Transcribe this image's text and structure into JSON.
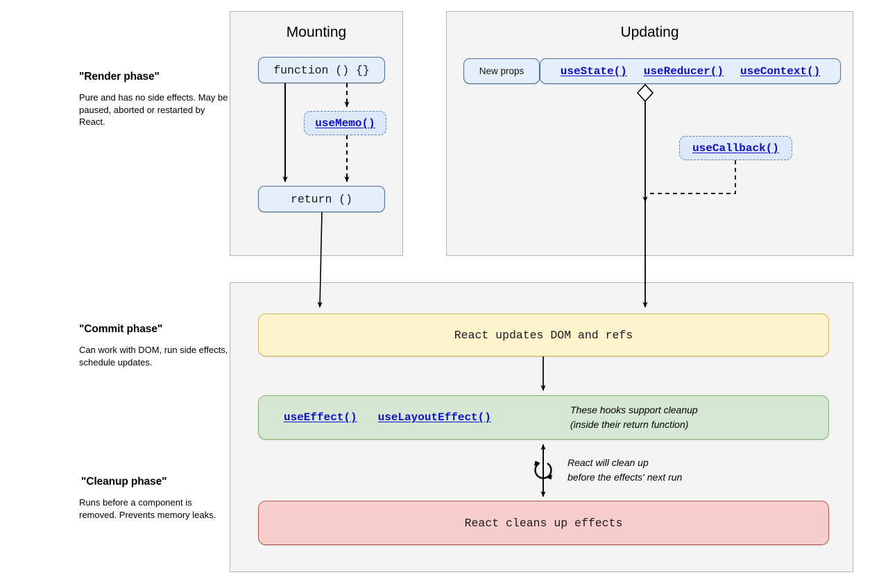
{
  "phases": [
    {
      "id": "render",
      "title": "\"Render phase\"",
      "description": "Pure and has no side effects. May be paused, aborted or restarted by React."
    },
    {
      "id": "commit",
      "title": "\"Commit phase\"",
      "description": "Can work with DOM, run side effects, schedule updates."
    },
    {
      "id": "cleanup",
      "title": "\"Cleanup phase\"",
      "description": "Runs before a component is removed. Prevents memory leaks."
    }
  ],
  "panels": {
    "mounting": {
      "title": "Mounting"
    },
    "updating": {
      "title": "Updating"
    },
    "commit": {
      "title": ""
    }
  },
  "mounting": {
    "function_box": "function () {}",
    "usememo": "useMemo()",
    "return_box": "return ()"
  },
  "updating": {
    "new_props": "New props",
    "hooks": [
      "useState()",
      "useReducer()",
      "useContext()"
    ],
    "usecallback": "useCallback()"
  },
  "commit": {
    "updates_dom": "React updates DOM and refs",
    "effect_hooks": [
      "useEffect()",
      "useLayoutEffect()"
    ],
    "effects_note_line1": "These hooks support cleanup",
    "effects_note_line2": "(inside their return function)",
    "cycle_note_line1": "React will clean up",
    "cycle_note_line2": "before the effects' next run",
    "cleans_up": "React cleans up effects"
  },
  "colors": {
    "panel_bg": "#f4f4f4",
    "panel_border": "#b3b3b3",
    "blue_fill": "#e5effb",
    "blue_border": "#4b6f9e",
    "dashed_fill": "#dce9fa",
    "dashed_border": "#5b7fb5",
    "yellow_fill": "#fdf3cd",
    "yellow_border": "#d6b656",
    "green_fill": "#d5e8d4",
    "green_border": "#82b366",
    "red_fill": "#f8cecc",
    "red_border": "#b85450",
    "link_blue": "#0e0ecb",
    "line": "#000000"
  }
}
